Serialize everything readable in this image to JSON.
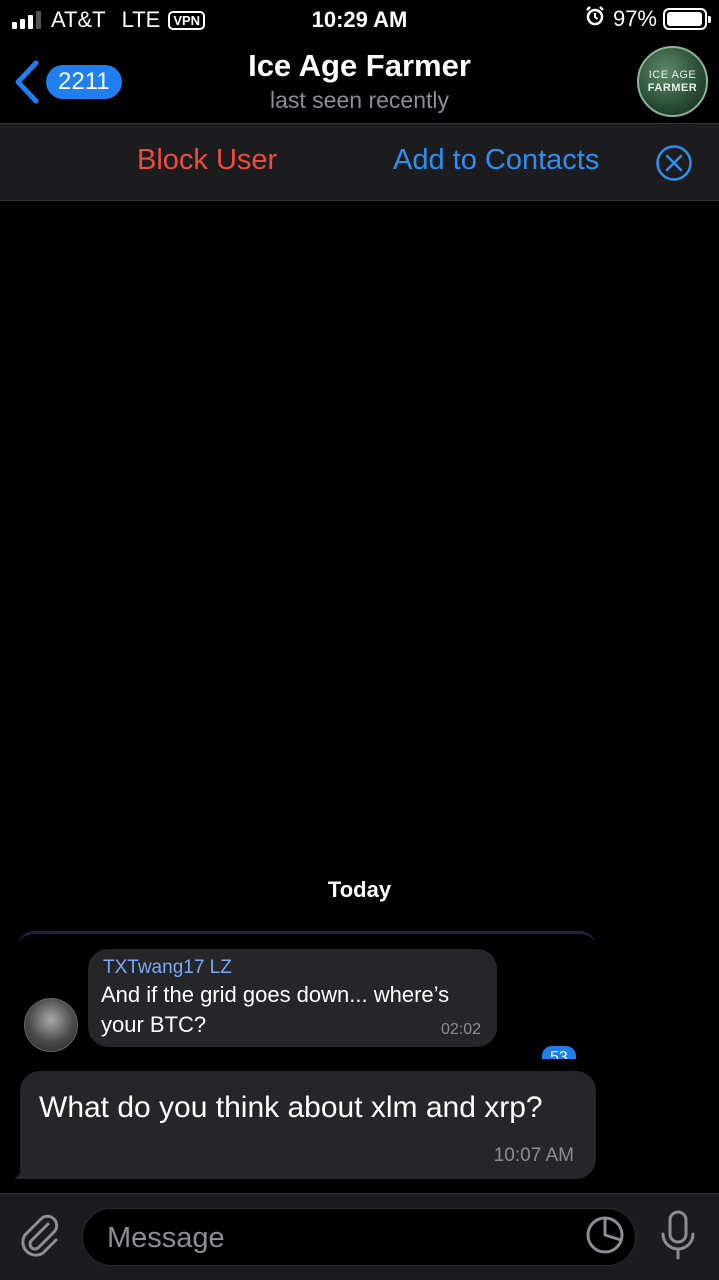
{
  "status_bar": {
    "carrier": "AT&T",
    "network": "LTE",
    "vpn": "VPN",
    "time": "10:29 AM",
    "battery": "97%",
    "battery_level": 0.97,
    "icons": [
      "signal-icon",
      "alarm-icon",
      "battery-icon"
    ]
  },
  "header": {
    "back_count": "2211",
    "title": "Ice Age Farmer",
    "subtitle": "last seen recently",
    "avatar_line1": "ICE AGE",
    "avatar_line2": "FARMER"
  },
  "actions": {
    "block": "Block User",
    "add": "Add to Contacts"
  },
  "chat": {
    "date": "Today",
    "forwarded": {
      "sender": "TXTwang17 LZ",
      "text": "And if the grid goes down... where’s your BTC?",
      "time": "02:02",
      "badge": "53"
    },
    "message": {
      "text": "What do you think about xlm and xrp?",
      "time": "10:07 AM"
    }
  },
  "input": {
    "placeholder": "Message"
  },
  "colors": {
    "accent": "#1f7ff0",
    "danger": "#eb4d3d",
    "bubble": "#262628",
    "bar": "#1c1c1e"
  }
}
